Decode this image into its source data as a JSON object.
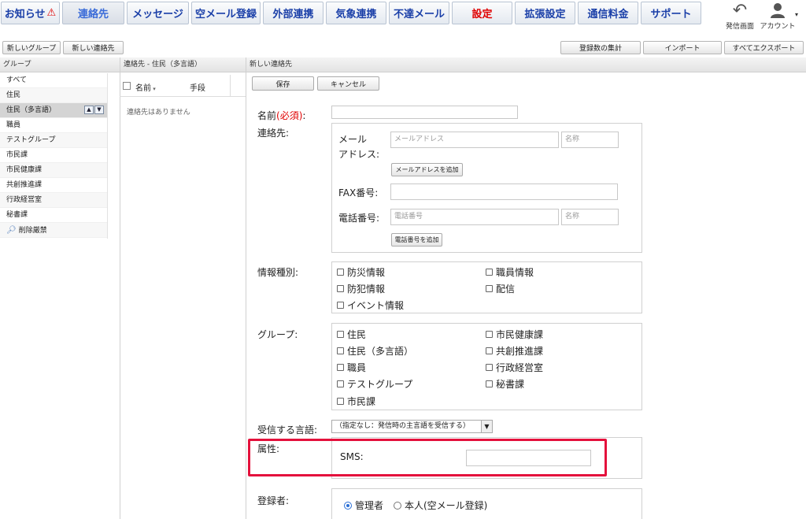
{
  "nav": {
    "items": [
      "お知らせ",
      "連絡先",
      "メッセージ",
      "空メール登録",
      "外部連携",
      "気象連携",
      "不達メール",
      "設定",
      "拡張設定",
      "通信料金",
      "サポート"
    ],
    "send_screen": "発信画面",
    "account": "アカウント"
  },
  "toolbar": {
    "new_group": "新しいグループ",
    "new_contact": "新しい連絡先",
    "count_summary": "登録数の集計",
    "import": "インポート",
    "export_all": "すべてエクスポート"
  },
  "groups_panel": {
    "header": "グループ",
    "items": [
      "すべて",
      "住民",
      "住民（多言語）",
      "職員",
      "テストグループ",
      "市民課",
      "市民健康課",
      "共創推進課",
      "行政経営室",
      "秘書課",
      "削除厳禁"
    ]
  },
  "contacts_panel": {
    "header": "連絡先 - 住民（多言語）",
    "col_name": "名前",
    "col_method": "手段",
    "empty": "連絡先はありません"
  },
  "form": {
    "header": "新しい連絡先",
    "save": "保存",
    "cancel": "キャンセル",
    "name_label": "名前",
    "required": "(必須)",
    "colon": ":",
    "contact_label": "連絡先:",
    "mail_label_1": "メール",
    "mail_label_2": "アドレス:",
    "mail_placeholder": "メールアドレス",
    "name_placeholder": "名称",
    "add_mail": "メールアドレスを追加",
    "fax_label": "FAX番号:",
    "phone_label": "電話番号:",
    "phone_placeholder": "電話番号",
    "add_phone": "電話番号を追加",
    "info_label": "情報種別:",
    "info_items": [
      "防災情報",
      "職員情報",
      "防犯情報",
      "配信",
      "イベント情報"
    ],
    "group_label": "グループ:",
    "group_items": [
      "住民",
      "市民健康課",
      "住民（多言語）",
      "共創推進課",
      "職員",
      "行政経営室",
      "テストグループ",
      "秘書課",
      "市民課"
    ],
    "lang_label": "受信する言語:",
    "lang_value": "（指定なし：発信時の主言語を受信する）",
    "attr_label": "属性:",
    "sms_label": "SMS:",
    "registrant_label": "登録者:",
    "registrant_admin": "管理者",
    "registrant_self": "本人(空メール登録)"
  },
  "colors": {
    "nav_text": "#1a3fa8",
    "settings_red": "#e00000",
    "highlight_box": "#e4113c",
    "radio_blue": "#2b6fd6"
  }
}
